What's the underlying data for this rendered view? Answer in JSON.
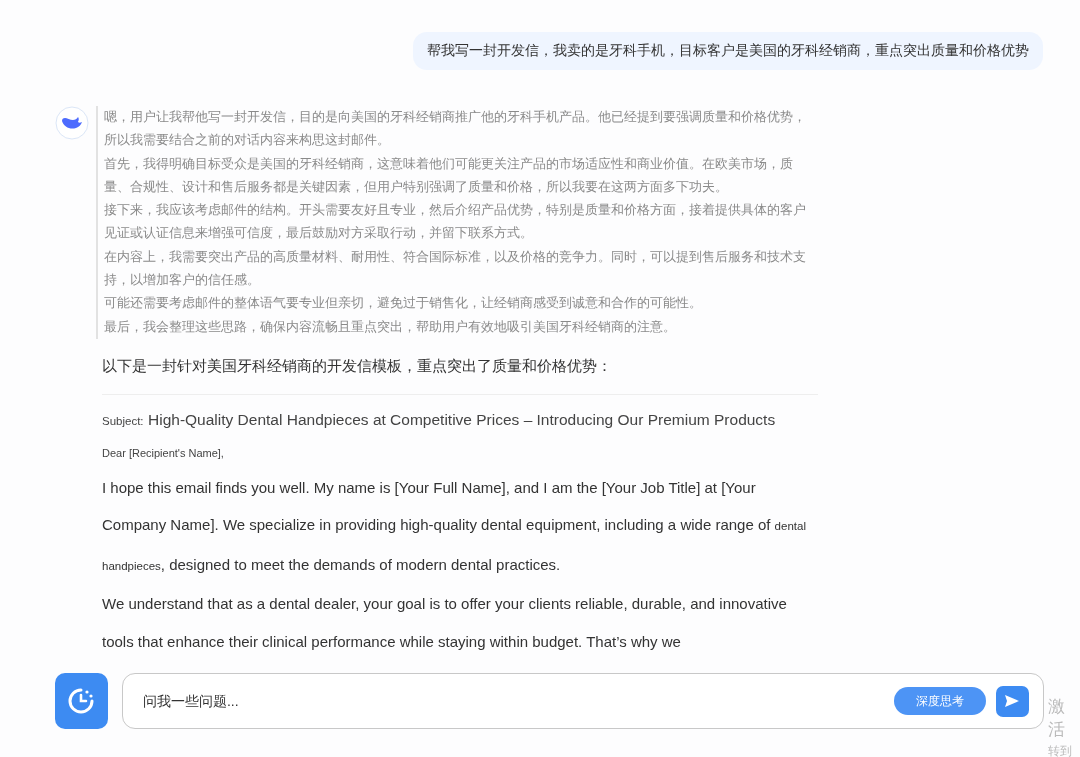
{
  "user_message": "帮我写一封开发信，我卖的是牙科手机，目标客户是美国的牙科经销商，重点突出质量和价格优势",
  "thinking": [
    "嗯，用户让我帮他写一封开发信，目的是向美国的牙科经销商推广他的牙科手机产品。他已经提到要强调质量和价格优势，所以我需要结合之前的对话内容来构思这封邮件。",
    "首先，我得明确目标受众是美国的牙科经销商，这意味着他们可能更关注产品的市场适应性和商业价值。在欧美市场，质量、合规性、设计和售后服务都是关键因素，但用户特别强调了质量和价格，所以我要在这两方面多下功夫。",
    "接下来，我应该考虑邮件的结构。开头需要友好且专业，然后介绍产品优势，特别是质量和价格方面，接着提供具体的客户见证或认证信息来增强可信度，最后鼓励对方采取行动，并留下联系方式。",
    "在内容上，我需要突出产品的高质量材料、耐用性、符合国际标准，以及价格的竞争力。同时，可以提到售后服务和技术支持，以增加客户的信任感。",
    "可能还需要考虑邮件的整体语气要专业但亲切，避免过于销售化，让经销商感受到诚意和合作的可能性。",
    "最后，我会整理这些思路，确保内容流畅且重点突出，帮助用户有效地吸引美国牙科经销商的注意。"
  ],
  "intro": "以下是一封针对美国牙科经销商的开发信模板，重点突出了质量和价格优势：",
  "subject_label": "Subject:",
  "subject": "High-Quality Dental Handpieces at Competitive Prices – Introducing Our Premium Products",
  "greeting": "Dear [Recipient's Name],",
  "paragraphs": [
    {
      "parts": [
        {
          "kind": "normal",
          "text": "I hope this email finds you well. My name is [Your Full Name], and I am the [Your Job Title] at [Your Company Name]. We specialize in providing high-quality dental equipment, including a wide range of "
        },
        {
          "kind": "small",
          "text": "dental handpieces"
        },
        {
          "kind": "normal",
          "text": ", designed to meet the demands of modern dental practices."
        }
      ]
    },
    {
      "parts": [
        {
          "kind": "normal",
          "text": "We understand that as a dental dealer, your goal is to offer your clients reliable, durable, and innovative tools that enhance their clinical performance while staying within budget. That’s why we"
        }
      ]
    }
  ],
  "input": {
    "placeholder": "问我一些问题..."
  },
  "deep_think_button": "深度思考",
  "overlay_lines": [
    "激活",
    "转到"
  ]
}
